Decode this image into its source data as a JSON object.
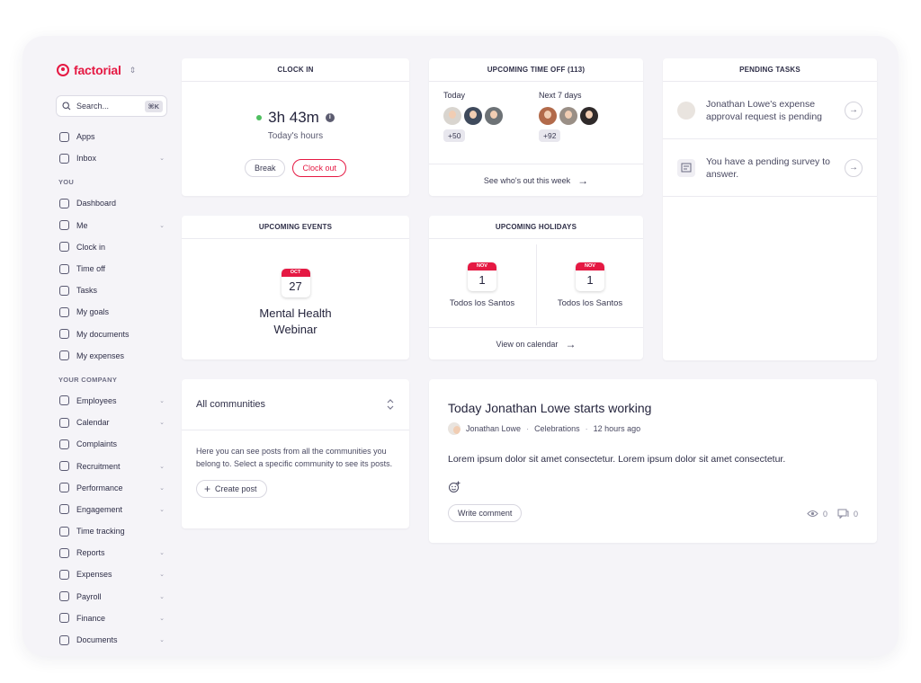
{
  "brand": {
    "name": "factorial",
    "color": "#e51943"
  },
  "search": {
    "placeholder": "Search...",
    "shortcut": "⌘K"
  },
  "nav": {
    "top": [
      {
        "label": "Apps",
        "icon": "apps-icon",
        "chevron": false
      },
      {
        "label": "Inbox",
        "icon": "inbox-icon",
        "chevron": true
      }
    ],
    "you_title": "YOU",
    "you": [
      {
        "label": "Dashboard",
        "icon": "home-icon",
        "chevron": false
      },
      {
        "label": "Me",
        "icon": "user-icon",
        "chevron": true
      },
      {
        "label": "Clock in",
        "icon": "clock-icon",
        "chevron": false
      },
      {
        "label": "Time off",
        "icon": "palm-tree-icon",
        "chevron": false
      },
      {
        "label": "Tasks",
        "icon": "check-circle-icon",
        "chevron": false
      },
      {
        "label": "My goals",
        "icon": "flag-icon",
        "chevron": false
      },
      {
        "label": "My documents",
        "icon": "document-icon",
        "chevron": false
      },
      {
        "label": "My expenses",
        "icon": "receipt-icon",
        "chevron": false
      }
    ],
    "company_title": "YOUR COMPANY",
    "company": [
      {
        "label": "Employees",
        "icon": "people-icon",
        "chevron": true
      },
      {
        "label": "Calendar",
        "icon": "calendar-icon",
        "chevron": true
      },
      {
        "label": "Complaints",
        "icon": "chat-icon",
        "chevron": false
      },
      {
        "label": "Recruitment",
        "icon": "search-person-icon",
        "chevron": true
      },
      {
        "label": "Performance",
        "icon": "trend-icon",
        "chevron": true
      },
      {
        "label": "Engagement",
        "icon": "smile-icon",
        "chevron": true
      },
      {
        "label": "Time tracking",
        "icon": "stopwatch-icon",
        "chevron": false
      },
      {
        "label": "Reports",
        "icon": "bar-chart-icon",
        "chevron": true
      },
      {
        "label": "Expenses",
        "icon": "receipt-icon",
        "chevron": true
      },
      {
        "label": "Payroll",
        "icon": "money-icon",
        "chevron": true
      },
      {
        "label": "Finance",
        "icon": "bank-icon",
        "chevron": true
      },
      {
        "label": "Documents",
        "icon": "folder-icon",
        "chevron": true
      }
    ]
  },
  "clock_in": {
    "title": "CLOCK IN",
    "time": "3h 43m",
    "subtitle": "Today's hours",
    "break_label": "Break",
    "clock_out_label": "Clock out",
    "status_color": "#4fbf60"
  },
  "time_off": {
    "title": "UPCOMING TIME OFF (113)",
    "today_label": "Today",
    "today_more": "+50",
    "next_label": "Next 7 days",
    "next_more": "+92",
    "footer": "See who's out this week"
  },
  "tasks": {
    "title": "PENDING TASKS",
    "items": [
      {
        "text": "Jonathan Lowe's expense approval request is pending",
        "icon": "avatar"
      },
      {
        "text": "You have a pending survey to answer.",
        "icon": "survey-icon"
      }
    ]
  },
  "events": {
    "title": "UPCOMING EVENTS",
    "month": "OCT",
    "day": "27",
    "name_line1": "Mental Health",
    "name_line2": "Webinar"
  },
  "holidays": {
    "title": "UPCOMING HOLIDAYS",
    "items": [
      {
        "month": "NOV",
        "day": "1",
        "name": "Todos los Santos"
      },
      {
        "month": "NOV",
        "day": "1",
        "name": "Todos los Santos"
      }
    ],
    "footer": "View on calendar"
  },
  "communities": {
    "selector": "All communities",
    "description": "Here you can see posts from all the communities you belong to. Select a specific community to see its posts.",
    "create_label": "Create post"
  },
  "post": {
    "title": "Today Jonathan Lowe starts working",
    "author": "Jonathan Lowe",
    "community": "Celebrations",
    "time": "12 hours ago",
    "body": "Lorem ipsum dolor sit amet consectetur. Lorem ipsum dolor sit amet consectetur.",
    "comment_label": "Write comment",
    "views": "0",
    "comments": "0"
  }
}
